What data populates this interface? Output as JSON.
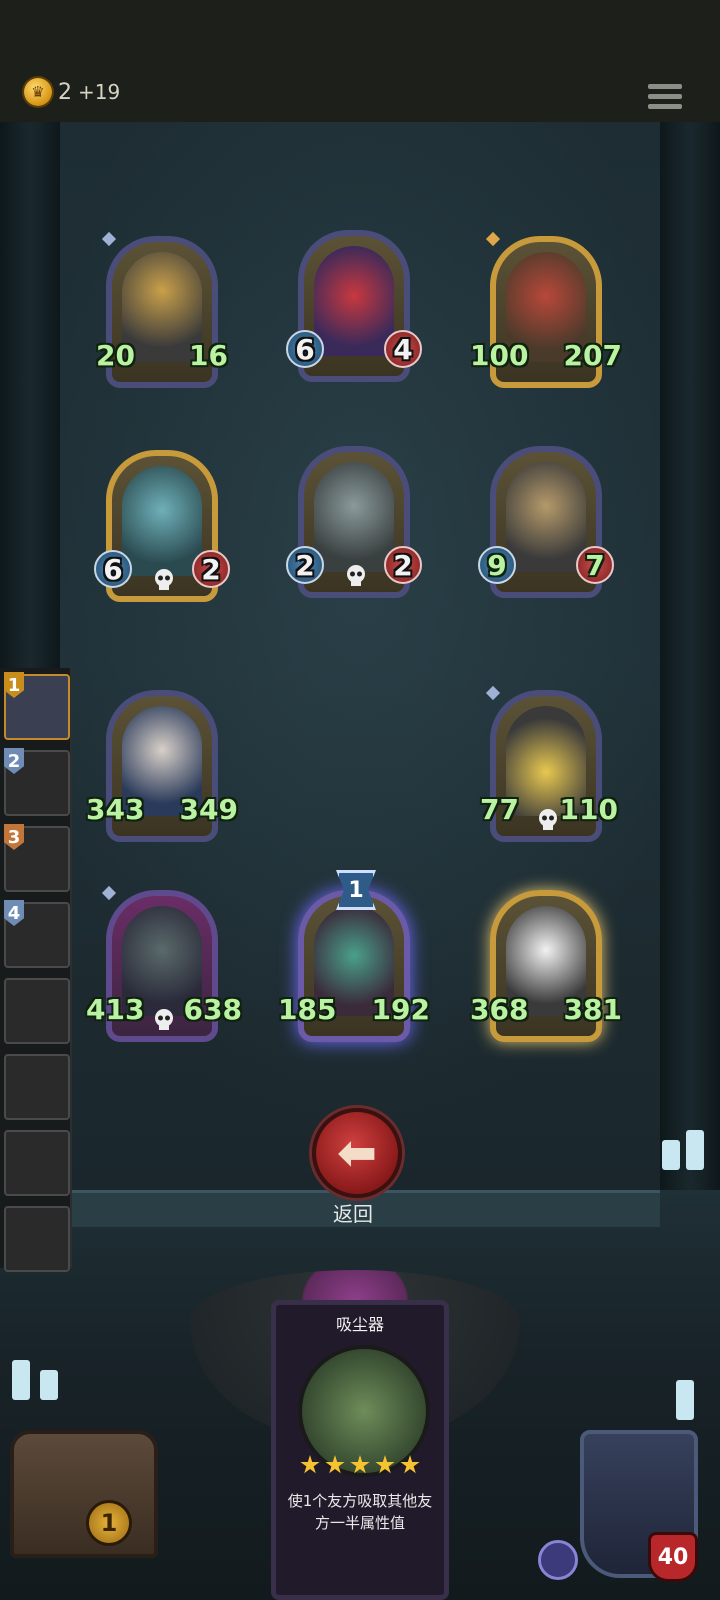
{
  "header": {
    "gold": "2",
    "gold_income": "+19"
  },
  "board": {
    "units": [
      {
        "name": "robot-warrior",
        "atk": "20",
        "hp": "16",
        "frame": "normal"
      },
      {
        "name": "clown",
        "atk": "6",
        "hp": "4",
        "frame": "normal"
      },
      {
        "name": "red-box-creature",
        "atk": "100",
        "hp": "207",
        "frame": "gold"
      },
      {
        "name": "blue-bunny",
        "atk": "6",
        "hp": "2",
        "frame": "gold"
      },
      {
        "name": "bin-robot",
        "atk": "2",
        "hp": "2",
        "frame": "normal"
      },
      {
        "name": "rocket",
        "atk": "9",
        "hp": "7",
        "frame": "normal"
      },
      {
        "name": "wizard",
        "atk": "343",
        "hp": "349",
        "frame": "normal"
      },
      {
        "name": "cheese-robot",
        "atk": "77",
        "hp": "110",
        "frame": "normal"
      },
      {
        "name": "frankenstein",
        "atk": "413",
        "hp": "638",
        "frame": "pink"
      },
      {
        "name": "crocodile-witch",
        "atk": "185",
        "hp": "192",
        "frame": "purple",
        "tier": "1"
      },
      {
        "name": "cow-dog",
        "atk": "368",
        "hp": "381",
        "frame": "gold"
      }
    ]
  },
  "sidebar": {
    "slots": [
      {
        "num": "1",
        "active": true
      },
      {
        "num": "2"
      },
      {
        "num": "3"
      },
      {
        "num": "4"
      },
      {
        "num": ""
      },
      {
        "num": ""
      },
      {
        "num": ""
      },
      {
        "num": ""
      }
    ]
  },
  "controls": {
    "back_label": "返回"
  },
  "card": {
    "title": "吸尘器",
    "stars": 5,
    "description": "使1个友方吸取其他友方一半属性值"
  },
  "chest": {
    "count": "1"
  },
  "hero": {
    "hp": "40"
  },
  "colors": {
    "gold_frame": "#c79a3c",
    "normal_frame": "#4a4d7a",
    "attack_badge": "#2f6a98",
    "health_badge": "#b03636",
    "stat_text": "#b9f3a1"
  }
}
